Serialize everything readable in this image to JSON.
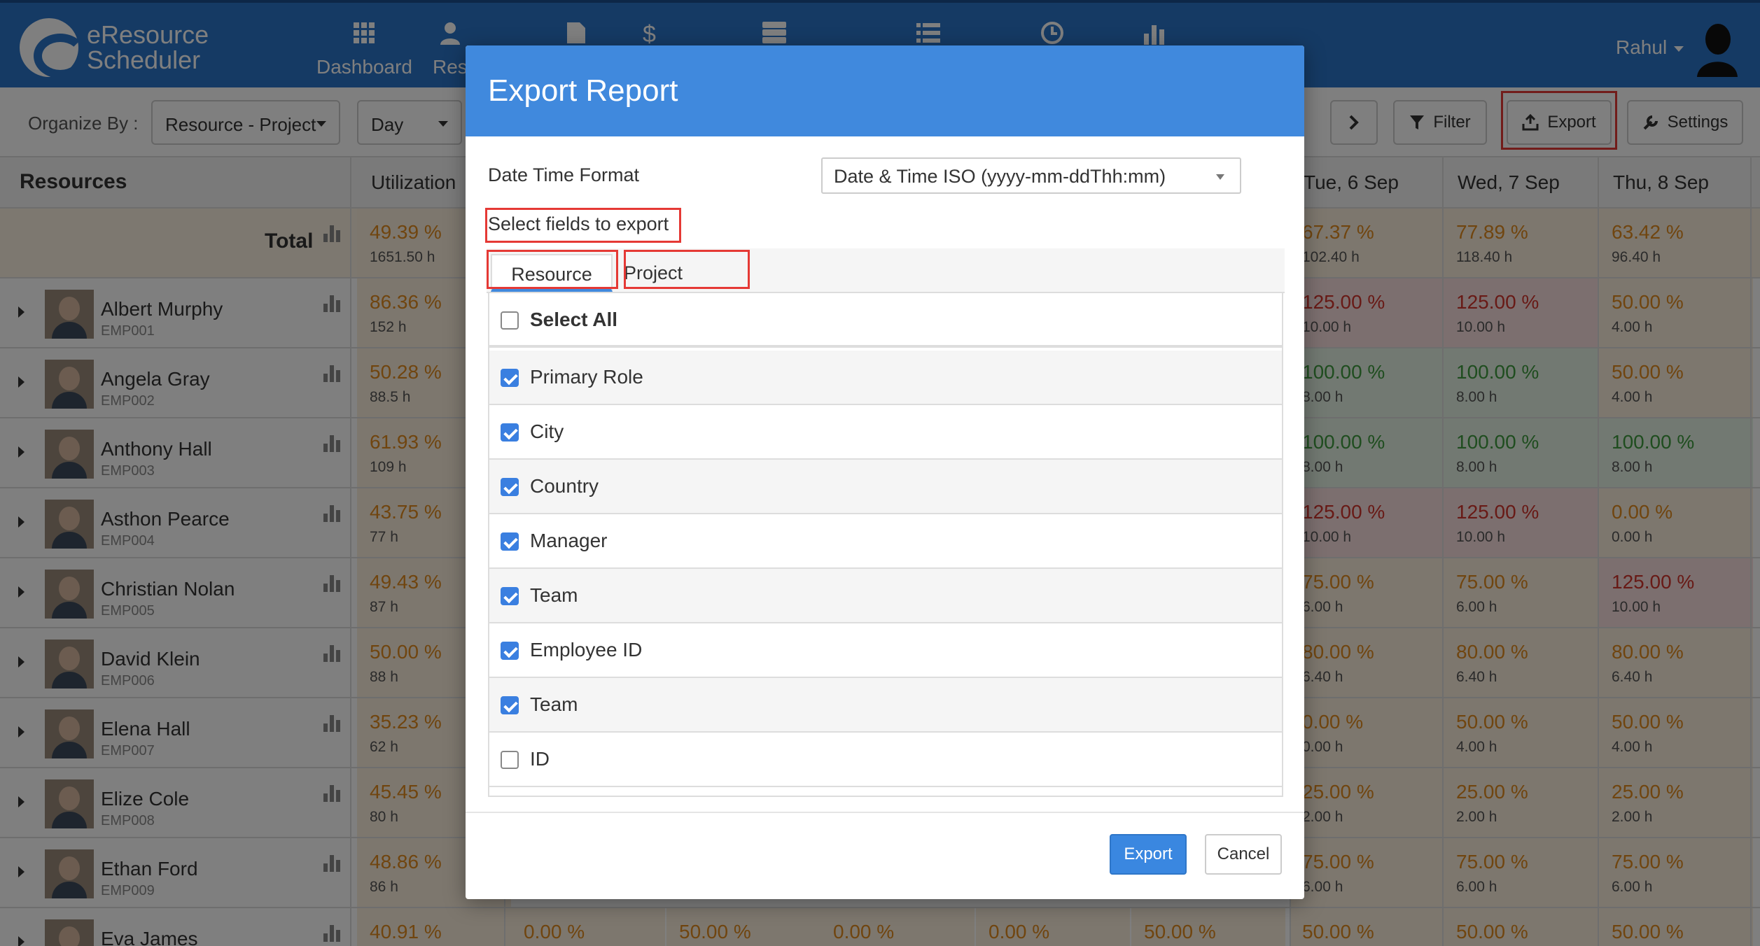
{
  "app": {
    "name_line1": "eResource",
    "name_line2": "Scheduler",
    "nav": [
      {
        "label": "Dashboard",
        "icon": "dashboard-icon"
      },
      {
        "label": "Res",
        "icon": "person-icon"
      },
      {
        "label": "",
        "icon": "document-icon"
      },
      {
        "label": "",
        "icon": "dollar-icon"
      },
      {
        "label": "",
        "icon": "server-icon"
      },
      {
        "label": "",
        "icon": "list-icon"
      },
      {
        "label": "",
        "icon": "clock-icon"
      },
      {
        "label": "",
        "icon": "bar-chart-icon"
      }
    ],
    "user": "Rahul"
  },
  "toolbar": {
    "organize_label": "Organize By :",
    "organize_value": "Resource - Project",
    "period_value": "Day",
    "filter_label": "Filter",
    "export_label": "Export",
    "settings_label": "Settings"
  },
  "grid": {
    "resources_title": "Resources",
    "utilization_title": "Utilization",
    "date_headers": [
      "Tue, 6 Sep",
      "Wed, 7 Sep",
      "Thu, 8 Sep"
    ],
    "total": {
      "label": "Total",
      "utilization": {
        "pct": "49.39 %",
        "hrs": "1651.50 h"
      },
      "days": [
        {
          "pct": "67.37 %",
          "hrs": "102.40 h",
          "tone": "orange"
        },
        {
          "pct": "77.89 %",
          "hrs": "118.40 h",
          "tone": "orange"
        },
        {
          "pct": "63.42 %",
          "hrs": "96.40 h",
          "tone": "orange"
        }
      ]
    },
    "rows": [
      {
        "name": "Albert Murphy",
        "emp": "EMP001",
        "util": {
          "pct": "86.36 %",
          "hrs": "152 h",
          "tone": "orange"
        },
        "days": [
          {
            "pct": "125.00 %",
            "hrs": "10.00 h",
            "tone": "red"
          },
          {
            "pct": "125.00 %",
            "hrs": "10.00 h",
            "tone": "red"
          },
          {
            "pct": "50.00 %",
            "hrs": "4.00 h",
            "tone": "orange"
          }
        ]
      },
      {
        "name": "Angela Gray",
        "emp": "EMP002",
        "util": {
          "pct": "50.28 %",
          "hrs": "88.5 h",
          "tone": "orange"
        },
        "days": [
          {
            "pct": "100.00 %",
            "hrs": "8.00 h",
            "tone": "green"
          },
          {
            "pct": "100.00 %",
            "hrs": "8.00 h",
            "tone": "green"
          },
          {
            "pct": "50.00 %",
            "hrs": "4.00 h",
            "tone": "orange"
          }
        ]
      },
      {
        "name": "Anthony Hall",
        "emp": "EMP003",
        "util": {
          "pct": "61.93 %",
          "hrs": "109 h",
          "tone": "orange"
        },
        "days": [
          {
            "pct": "100.00 %",
            "hrs": "8.00 h",
            "tone": "green"
          },
          {
            "pct": "100.00 %",
            "hrs": "8.00 h",
            "tone": "green"
          },
          {
            "pct": "100.00 %",
            "hrs": "8.00 h",
            "tone": "green"
          }
        ]
      },
      {
        "name": "Asthon Pearce",
        "emp": "EMP004",
        "util": {
          "pct": "43.75 %",
          "hrs": "77 h",
          "tone": "orange"
        },
        "days": [
          {
            "pct": "125.00 %",
            "hrs": "10.00 h",
            "tone": "red"
          },
          {
            "pct": "125.00 %",
            "hrs": "10.00 h",
            "tone": "red"
          },
          {
            "pct": "0.00 %",
            "hrs": "0.00 h",
            "tone": "orange"
          }
        ]
      },
      {
        "name": "Christian Nolan",
        "emp": "EMP005",
        "util": {
          "pct": "49.43 %",
          "hrs": "87 h",
          "tone": "orange"
        },
        "days": [
          {
            "pct": "75.00 %",
            "hrs": "6.00 h",
            "tone": "orange"
          },
          {
            "pct": "75.00 %",
            "hrs": "6.00 h",
            "tone": "orange"
          },
          {
            "pct": "125.00 %",
            "hrs": "10.00 h",
            "tone": "red"
          }
        ]
      },
      {
        "name": "David Klein",
        "emp": "EMP006",
        "util": {
          "pct": "50.00 %",
          "hrs": "88 h",
          "tone": "orange"
        },
        "days": [
          {
            "pct": "80.00 %",
            "hrs": "6.40 h",
            "tone": "orange"
          },
          {
            "pct": "80.00 %",
            "hrs": "6.40 h",
            "tone": "orange"
          },
          {
            "pct": "80.00 %",
            "hrs": "6.40 h",
            "tone": "orange"
          }
        ]
      },
      {
        "name": "Elena Hall",
        "emp": "EMP007",
        "util": {
          "pct": "35.23 %",
          "hrs": "62 h",
          "tone": "orange"
        },
        "days": [
          {
            "pct": "0.00 %",
            "hrs": "0.00 h",
            "tone": "orange"
          },
          {
            "pct": "50.00 %",
            "hrs": "4.00 h",
            "tone": "orange"
          },
          {
            "pct": "50.00 %",
            "hrs": "4.00 h",
            "tone": "orange"
          }
        ]
      },
      {
        "name": "Elize Cole",
        "emp": "EMP008",
        "util": {
          "pct": "45.45 %",
          "hrs": "80 h",
          "tone": "orange"
        },
        "days": [
          {
            "pct": "25.00 %",
            "hrs": "2.00 h",
            "tone": "orange"
          },
          {
            "pct": "25.00 %",
            "hrs": "2.00 h",
            "tone": "orange"
          },
          {
            "pct": "25.00 %",
            "hrs": "2.00 h",
            "tone": "orange"
          }
        ]
      },
      {
        "name": "Ethan Ford",
        "emp": "EMP009",
        "util": {
          "pct": "48.86 %",
          "hrs": "86 h",
          "tone": "orange"
        },
        "days": [
          {
            "pct": "75.00 %",
            "hrs": "6.00 h",
            "tone": "orange"
          },
          {
            "pct": "75.00 %",
            "hrs": "6.00 h",
            "tone": "orange"
          },
          {
            "pct": "75.00 %",
            "hrs": "6.00 h",
            "tone": "orange"
          }
        ]
      },
      {
        "name": "Eva James",
        "emp": "",
        "util": {
          "pct": "40.91 %",
          "hrs": "",
          "tone": "orange"
        },
        "days": [
          {
            "pct": "50.00 %",
            "hrs": "",
            "tone": "orange"
          },
          {
            "pct": "50.00 %",
            "hrs": "",
            "tone": "orange"
          },
          {
            "pct": "50.00 %",
            "hrs": "",
            "tone": "orange"
          }
        ],
        "mid": [
          "0.00 %",
          "50.00 %",
          "0.00 %",
          "0.00 %",
          "50.00 %"
        ]
      }
    ]
  },
  "modal": {
    "title": "Export Report",
    "dtf_label": "Date Time Format",
    "dtf_value": "Date & Time ISO (yyyy-mm-ddThh:mm)",
    "select_fields_label": "Select fields to export",
    "tabs": [
      "Resource",
      "Project"
    ],
    "select_all_label": "Select All",
    "fields": [
      {
        "label": "Primary Role",
        "checked": true
      },
      {
        "label": "City",
        "checked": true
      },
      {
        "label": "Country",
        "checked": true
      },
      {
        "label": "Manager",
        "checked": true
      },
      {
        "label": "Team",
        "checked": true
      },
      {
        "label": "Employee ID",
        "checked": true
      },
      {
        "label": "Team",
        "checked": true
      },
      {
        "label": "ID",
        "checked": false
      }
    ],
    "export_button": "Export",
    "cancel_button": "Cancel"
  },
  "colors": {
    "nav_blue": "#2b74c9",
    "modal_header_blue": "#4089dd",
    "primary_button": "#3a87e0",
    "highlight_red": "#e53935",
    "pct_orange": "#e08a1e",
    "pct_green": "#3f9a3f",
    "pct_red": "#d0342c"
  }
}
